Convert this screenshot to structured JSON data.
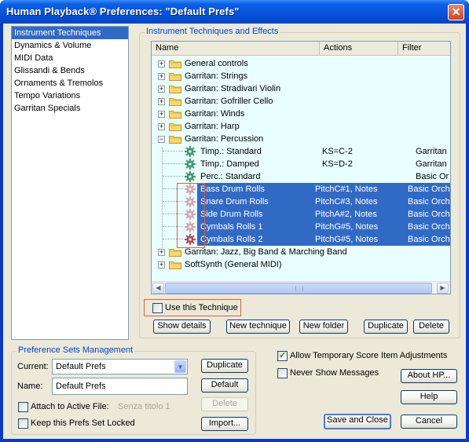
{
  "window": {
    "title": "Human Playback® Preferences: \"Default Prefs\"",
    "close_glyph": "✕"
  },
  "categories": [
    {
      "label": "Instrument Techniques",
      "selected": true
    },
    {
      "label": "Dynamics & Volume"
    },
    {
      "label": "MIDI Data"
    },
    {
      "label": "Glissandi & Bends"
    },
    {
      "label": "Ornaments & Tremolos"
    },
    {
      "label": "Tempo Variations"
    },
    {
      "label": "Garritan Specials"
    }
  ],
  "techniques": {
    "group_label": "Instrument Techniques and Effects",
    "columns": {
      "name": "Name",
      "actions": "Actions",
      "filter": "Filter"
    },
    "rows": [
      {
        "type": "folder",
        "expander": "+",
        "label": "General controls"
      },
      {
        "type": "folder",
        "expander": "+",
        "label": "Garritan: Strings"
      },
      {
        "type": "folder",
        "expander": "+",
        "label": "Garritan: Stradivari Violin"
      },
      {
        "type": "folder",
        "expander": "+",
        "label": "Garritan: Gofriller Cello"
      },
      {
        "type": "folder",
        "expander": "+",
        "label": "Garritan: Winds"
      },
      {
        "type": "folder",
        "expander": "+",
        "label": "Garritan: Harp"
      },
      {
        "type": "folder",
        "expander": "−",
        "label": "Garritan: Percussion"
      },
      {
        "type": "item",
        "icon": "green-gear-icon",
        "label": "Timp.: Standard",
        "actions": "KS=C-2",
        "filter": "Garritan"
      },
      {
        "type": "item",
        "icon": "green-gear-icon",
        "label": "Timp.: Damped",
        "actions": "KS=D-2",
        "filter": "Garritan"
      },
      {
        "type": "item",
        "icon": "green-gear-icon",
        "label": "Perc.: Standard",
        "actions": "",
        "filter": "Basic Or"
      },
      {
        "type": "item",
        "icon": "pink-gear-icon",
        "label": "Bass Drum Rolls",
        "actions": "PitchC#1, Notes",
        "filter": "Basic Orch",
        "selected": true
      },
      {
        "type": "item",
        "icon": "pink-gear-icon",
        "label": "Snare Drum Rolls",
        "actions": "PitchC#3, Notes",
        "filter": "Basic Orch",
        "selected": true
      },
      {
        "type": "item",
        "icon": "pink-gear-icon",
        "label": "Side Drum Rolls",
        "actions": "PitchA#2, Notes",
        "filter": "Basic Orch",
        "selected": true
      },
      {
        "type": "item",
        "icon": "pink-gear-icon",
        "label": "Cymbals Rolls 1",
        "actions": "PitchG#5, Notes",
        "filter": "Basic Orch",
        "selected": true
      },
      {
        "type": "item",
        "icon": "red-gear-icon",
        "label": "Cymbals Rolls 2",
        "actions": "PitchG#5, Notes",
        "filter": "Basic Orch",
        "selected": true
      },
      {
        "type": "folder",
        "expander": "+",
        "label": "Garritan: Jazz, Big Band & Marching Band"
      },
      {
        "type": "folder",
        "expander": "+",
        "label": "SoftSynth (General MIDI)"
      }
    ],
    "use_technique_label": "Use this Technique",
    "buttons": {
      "show_details": "Show details",
      "new_technique": "New technique",
      "new_folder": "New folder",
      "duplicate": "Duplicate",
      "delete": "Delete"
    }
  },
  "prefsets": {
    "group_label": "Preference Sets Management",
    "current_label": "Current:",
    "current_value": "Default Prefs",
    "name_label": "Name:",
    "name_value": "Default Prefs",
    "attach_label": "Attach to Active File:",
    "attach_file": "Senza titolo 1",
    "keep_locked_label": "Keep this Prefs Set Locked",
    "buttons": {
      "duplicate": "Duplicate",
      "default": "Default",
      "delete": "Delete",
      "import": "Import..."
    }
  },
  "options": {
    "allow_temp_label": "Allow Temporary Score Item Adjustments",
    "allow_temp_checked": true,
    "never_show_label": "Never Show Messages",
    "never_show_checked": false
  },
  "footer_buttons": {
    "about": "About HP...",
    "help": "Help",
    "save_close": "Save and Close",
    "cancel": "Cancel"
  }
}
